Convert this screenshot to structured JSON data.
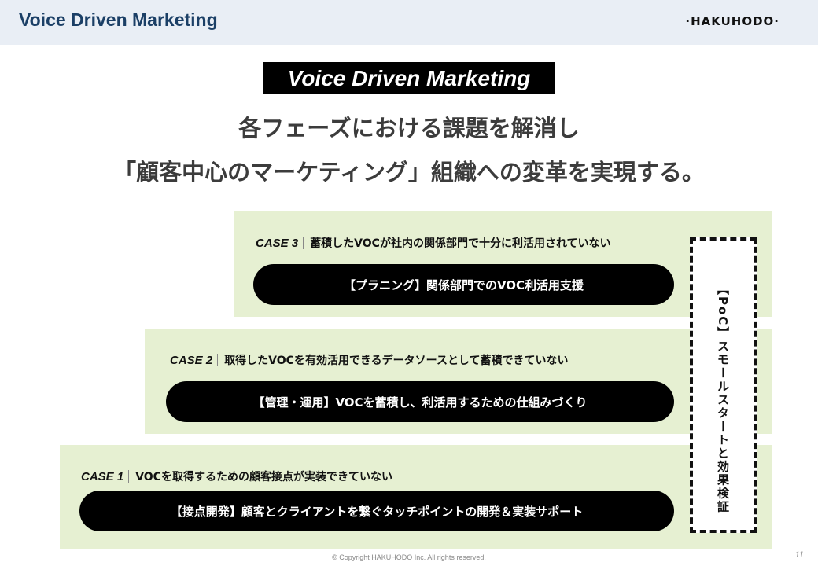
{
  "header": {
    "title": "Voice Driven Marketing",
    "brand": "·HAKUHODO·"
  },
  "hero": {
    "title": "Voice Driven Marketing",
    "headline_line1": "各フェーズにおける課題を解消し",
    "headline_line2": "「顧客中心のマーケティング」組織への変革を実現する。"
  },
  "cases": [
    {
      "label": "CASE 3",
      "issue": "蓄積したVOCが社内の関係部門で十分に利活用されていない",
      "solution": "【プラニング】関係部門でのVOC利活用支援"
    },
    {
      "label": "CASE 2",
      "issue": "取得したVOCを有効活用できるデータソースとして蓄積できていない",
      "solution": "【管理・運用】VOCを蓄積し、利活用するための仕組みづくり"
    },
    {
      "label": "CASE 1",
      "issue": "VOCを取得するための顧客接点が実装できていない",
      "solution": "【接点開発】顧客とクライアントを繋ぐタッチポイントの開発＆実装サポート"
    }
  ],
  "poc": {
    "text": "【PoC】スモールスタートと効果検証"
  },
  "footer": {
    "copyright": "© Copyright HAKUHODO Inc. All rights reserved.",
    "page_number": "11"
  },
  "colors": {
    "header_band": "#e9eef5",
    "header_title": "#1b3f66",
    "panel_green": "#e6f0d2",
    "pill_black": "#000000"
  }
}
